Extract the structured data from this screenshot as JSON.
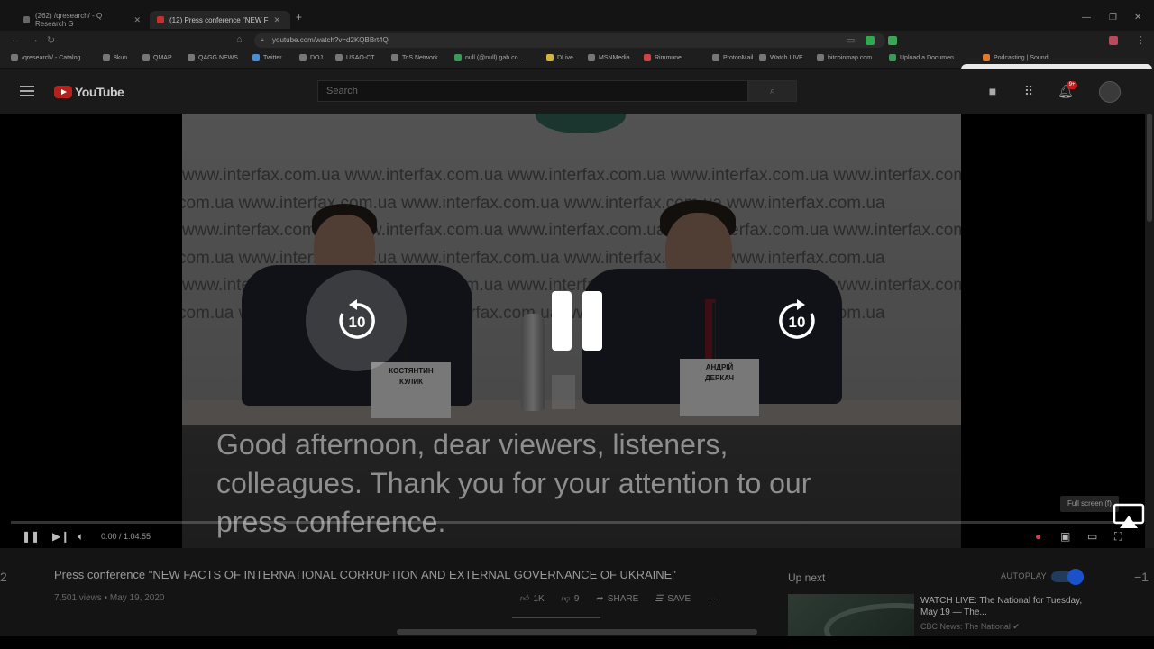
{
  "browser": {
    "tabs": [
      {
        "label": "(262) /qresearch/ - Q Research G"
      },
      {
        "label": "(12) Press conference \"NEW F"
      }
    ],
    "new_tab": "+",
    "url": "youtube.com/watch?v=d2KQBBrt4Q",
    "bookmarks": [
      {
        "label": "/qresearch/ - Catalog"
      },
      {
        "label": "8kun"
      },
      {
        "label": "QMAP"
      },
      {
        "label": "QAGG.NEWS"
      },
      {
        "label": "Twitter"
      },
      {
        "label": "DOJ"
      },
      {
        "label": "USAO-CT"
      },
      {
        "label": "ToS Network"
      },
      {
        "label": "null (@null) gab.co..."
      },
      {
        "label": "DLive"
      },
      {
        "label": "MSNMedia"
      },
      {
        "label": "Rimmune"
      },
      {
        "label": "ProtonMail"
      },
      {
        "label": "Watch LIVE"
      },
      {
        "label": "bitcoinmap.com"
      },
      {
        "label": "Upload a Documen..."
      },
      {
        "label": "Podcasting | Sound..."
      }
    ]
  },
  "youtube": {
    "logo_text": "YouTube",
    "search_placeholder": "Search",
    "notification_count": "9+"
  },
  "video": {
    "backdrop_text": "www.interfax.com.ua",
    "plate_left": [
      "КОСТЯНТИН",
      "КУЛИК"
    ],
    "plate_right": [
      "АНДРІЙ",
      "ДЕРКАЧ"
    ],
    "caption_lines": [
      "Good afternoon, dear viewers, listeners,",
      "colleagues. Thank you for your attention to our",
      "press conference."
    ],
    "skip_back_label": "10",
    "skip_fwd_label": "10",
    "time_display": "0:00 / 1:04:55",
    "progress_fraction": 0.0,
    "tooltip": "Full screen (f)"
  },
  "info": {
    "title": "Press conference \"NEW FACTS OF INTERNATIONAL CORRUPTION AND EXTERNAL GOVERNANCE OF UKRAINE\"",
    "meta": "7,501 views • May 19, 2020",
    "likes": "1K",
    "dislikes": "9",
    "share": "SHARE",
    "save": "SAVE",
    "more": "···",
    "edge_left": "2",
    "edge_right": "−1"
  },
  "upnext": {
    "heading": "Up next",
    "autoplay_label": "AUTOPLAY",
    "next_title": "WATCH LIVE: The National for Tuesday, May 19 — The...",
    "next_channel": "CBC News: The National"
  },
  "colors": {
    "youtube_red": "#b3221d",
    "progress_red": "#cc0000",
    "autoplay_blue": "#1a52c8"
  }
}
